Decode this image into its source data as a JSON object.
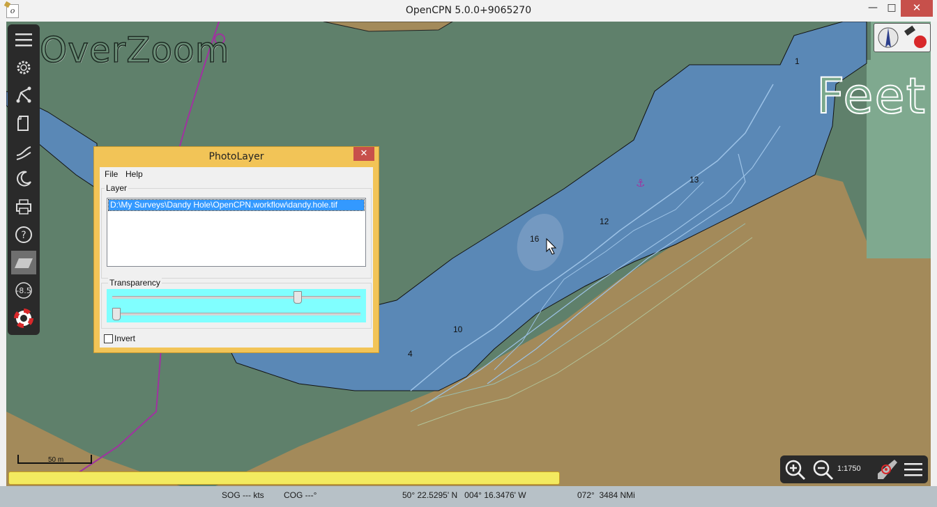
{
  "window": {
    "title": "OpenCPN 5.0.0+9065270",
    "minimize": "—",
    "maximize": "□",
    "close": "✕"
  },
  "chart": {
    "overzoom_label": "OverZoom",
    "units_label": "Feet",
    "soundings": [
      "1",
      "13",
      "12",
      "16",
      "10",
      "4"
    ],
    "colors": {
      "land": "#5f806b",
      "water": "#5a88b6",
      "shallow_sand": "#a38a5a",
      "drying": "#7fa98f",
      "track": "#a032a0"
    }
  },
  "toolbar": {
    "items": [
      {
        "name": "menu",
        "icon": "hamburger-icon"
      },
      {
        "name": "settings",
        "icon": "gear-icon"
      },
      {
        "name": "route",
        "icon": "route-icon"
      },
      {
        "name": "route-manager",
        "icon": "document-icon"
      },
      {
        "name": "track",
        "icon": "track-icon"
      },
      {
        "name": "color-scheme",
        "icon": "moon-icon"
      },
      {
        "name": "print",
        "icon": "printer-icon"
      },
      {
        "name": "help",
        "icon": "help-icon"
      },
      {
        "name": "photolayer",
        "icon": "layer-icon"
      },
      {
        "name": "tide",
        "icon": "tide-icon"
      },
      {
        "name": "mob",
        "icon": "lifebuoy-icon"
      }
    ],
    "tide_value": "-8.5"
  },
  "scale_bar": {
    "label": "50 m"
  },
  "zoom": {
    "scale": "1:1750"
  },
  "status": {
    "sog": "SOG --- kts",
    "cog": "COG ---°",
    "position": "50° 22.5295' N   004° 16.3476' W",
    "bearing_distance": "072°  3484 NMi"
  },
  "dialog": {
    "title": "PhotoLayer",
    "close": "✕",
    "menu": {
      "file": "File",
      "help": "Help"
    },
    "layer_group": "Layer",
    "layers": [
      "D:\\My Surveys\\Dandy Hole\\OpenCPN.workflow\\dandy.hole.tif"
    ],
    "transparency_group": "Transparency",
    "transparency_value": 0.75,
    "second_slider_value": 0.0,
    "invert_label": "Invert",
    "invert_checked": false
  }
}
